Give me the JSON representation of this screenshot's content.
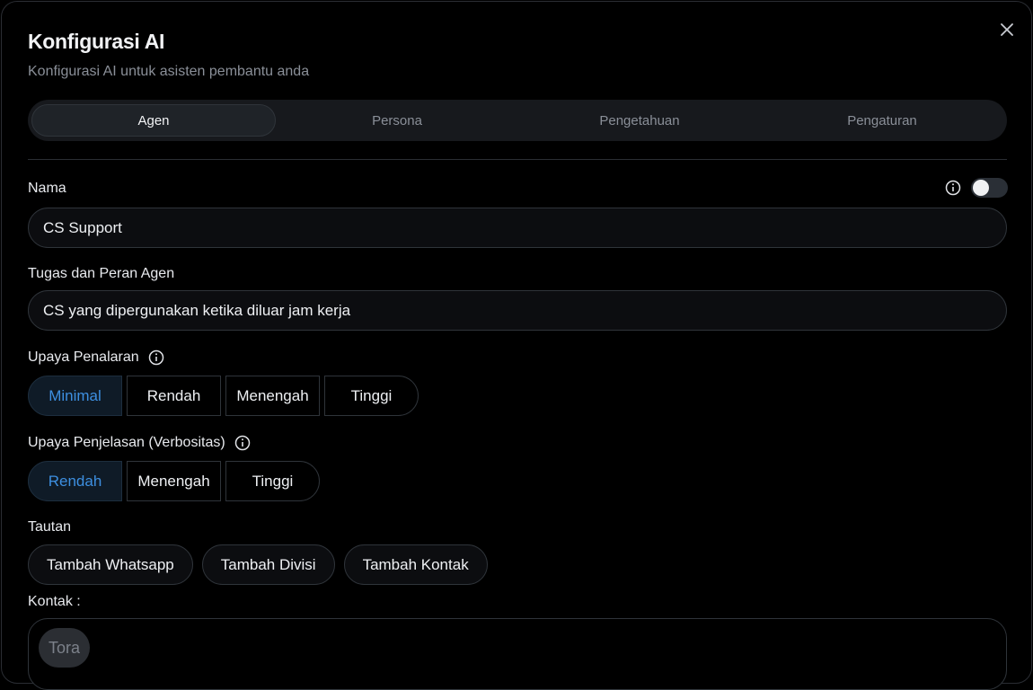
{
  "dialog": {
    "title": "Konfigurasi AI",
    "subtitle": "Konfigurasi AI untuk asisten pembantu anda",
    "close_icon": "close-icon"
  },
  "tabs": [
    {
      "label": "Agen",
      "active": true
    },
    {
      "label": "Persona",
      "active": false
    },
    {
      "label": "Pengetahuan",
      "active": false
    },
    {
      "label": "Pengaturan",
      "active": false
    }
  ],
  "name_field": {
    "label": "Nama",
    "value": "CS Support",
    "toggle_on": false,
    "info_icon": "info-icon"
  },
  "role_field": {
    "label": "Tugas dan Peran Agen",
    "value": "CS yang dipergunakan ketika diluar jam kerja"
  },
  "reasoning": {
    "label": "Upaya Penalaran",
    "options": [
      "Minimal",
      "Rendah",
      "Menengah",
      "Tinggi"
    ],
    "selected": "Minimal"
  },
  "verbosity": {
    "label": "Upaya Penjelasan (Verbositas)",
    "options": [
      "Rendah",
      "Menengah",
      "Tinggi"
    ],
    "selected": "Rendah"
  },
  "links": {
    "label": "Tautan",
    "buttons": [
      "Tambah Whatsapp",
      "Tambah Divisi",
      "Tambah Kontak"
    ]
  },
  "contacts": {
    "label": "Kontak :",
    "chips": [
      "Tora"
    ]
  },
  "colors": {
    "background": "#000000",
    "accent": "#3d8fe0",
    "border": "#2f343a"
  }
}
